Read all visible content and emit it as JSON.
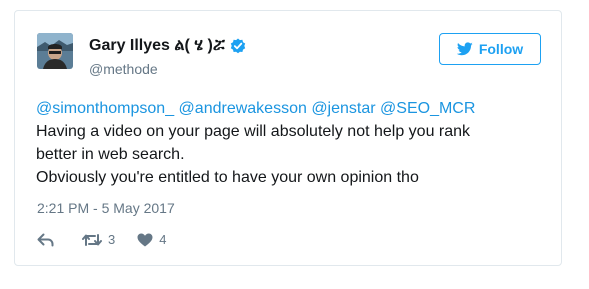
{
  "tweet": {
    "author": {
      "name": "Gary Illyes ል( ሄ )ሯ",
      "handle": "@methode",
      "verified": true,
      "avatar_icon": "avatar-photo"
    },
    "follow_label": "Follow",
    "mentions": [
      "@simonthompson_",
      "@andrewakesson",
      "@jenstar",
      "@SEO_MCR"
    ],
    "lines": [
      "Having a video on your page will absolutely not help you rank",
      "better in web search.",
      "Obviously you're entitled to have your own opinion tho"
    ],
    "timestamp": "2:21 PM - 5 May 2017",
    "actions": {
      "reply_icon": "reply-icon",
      "retweet_icon": "retweet-icon",
      "retweet_count": "3",
      "like_icon": "heart-icon",
      "like_count": "4"
    }
  },
  "colors": {
    "brand": "#1da1f2",
    "link": "#1b95e0",
    "text": "#14171a",
    "muted": "#657786",
    "border": "#e1e8ed"
  }
}
